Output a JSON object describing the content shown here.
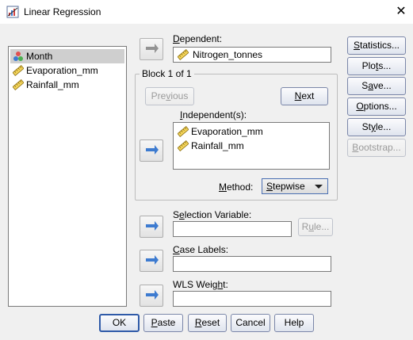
{
  "window": {
    "title": "Linear Regression",
    "close_label": "✕"
  },
  "variable_list": {
    "items": [
      {
        "label": "Month",
        "icon": "nominal-variable-icon",
        "selected": true
      },
      {
        "label": "Evaporation_mm",
        "icon": "scale-variable-icon",
        "selected": false
      },
      {
        "label": "Rainfall_mm",
        "icon": "scale-variable-icon",
        "selected": false
      }
    ]
  },
  "dependent": {
    "label_u": "D",
    "label_rest": "ependent:",
    "value": "Nitrogen_tonnes"
  },
  "block": {
    "title": "Block 1 of 1",
    "previous_u": "v",
    "previous_pre": "Pre",
    "previous_post": "ious",
    "next_u": "N",
    "next_rest": "ext"
  },
  "independents": {
    "label_u": "I",
    "label_rest": "ndependent(s):",
    "items": [
      {
        "label": "Evaporation_mm",
        "icon": "scale-variable-icon"
      },
      {
        "label": "Rainfall_mm",
        "icon": "scale-variable-icon"
      }
    ]
  },
  "method": {
    "label_u": "M",
    "label_rest": "ethod:",
    "value_u": "S",
    "value_rest": "tepwise"
  },
  "selection": {
    "label_pre": "S",
    "label_u": "e",
    "label_rest": "lection Variable:",
    "value": "",
    "rule_u": "u",
    "rule_pre": "R",
    "rule_post": "le..."
  },
  "case_labels": {
    "label_u": "C",
    "label_rest": "ase Labels:",
    "value": ""
  },
  "wls": {
    "label_pre": "WLS Weig",
    "label_u": "h",
    "label_rest": "t:",
    "value": ""
  },
  "side_buttons": {
    "statistics": {
      "u": "S",
      "rest": "tatistics..."
    },
    "plots": {
      "pre": "Plo",
      "u": "t",
      "rest": "s..."
    },
    "save": {
      "pre": "S",
      "u": "a",
      "rest": "ve..."
    },
    "options": {
      "u": "O",
      "rest": "ptions..."
    },
    "style": {
      "pre": "St",
      "u": "y",
      "rest": "le..."
    },
    "bootstrap": {
      "u": "B",
      "rest": "ootstrap..."
    }
  },
  "bottom_buttons": {
    "ok": "OK",
    "paste": {
      "u": "P",
      "rest": "aste"
    },
    "reset": {
      "u": "R",
      "rest": "eset"
    },
    "cancel": "Cancel",
    "help": "Help"
  },
  "colors": {
    "arrow_blue": "#3d7bd0",
    "accent_border": "#2f5aa8"
  }
}
